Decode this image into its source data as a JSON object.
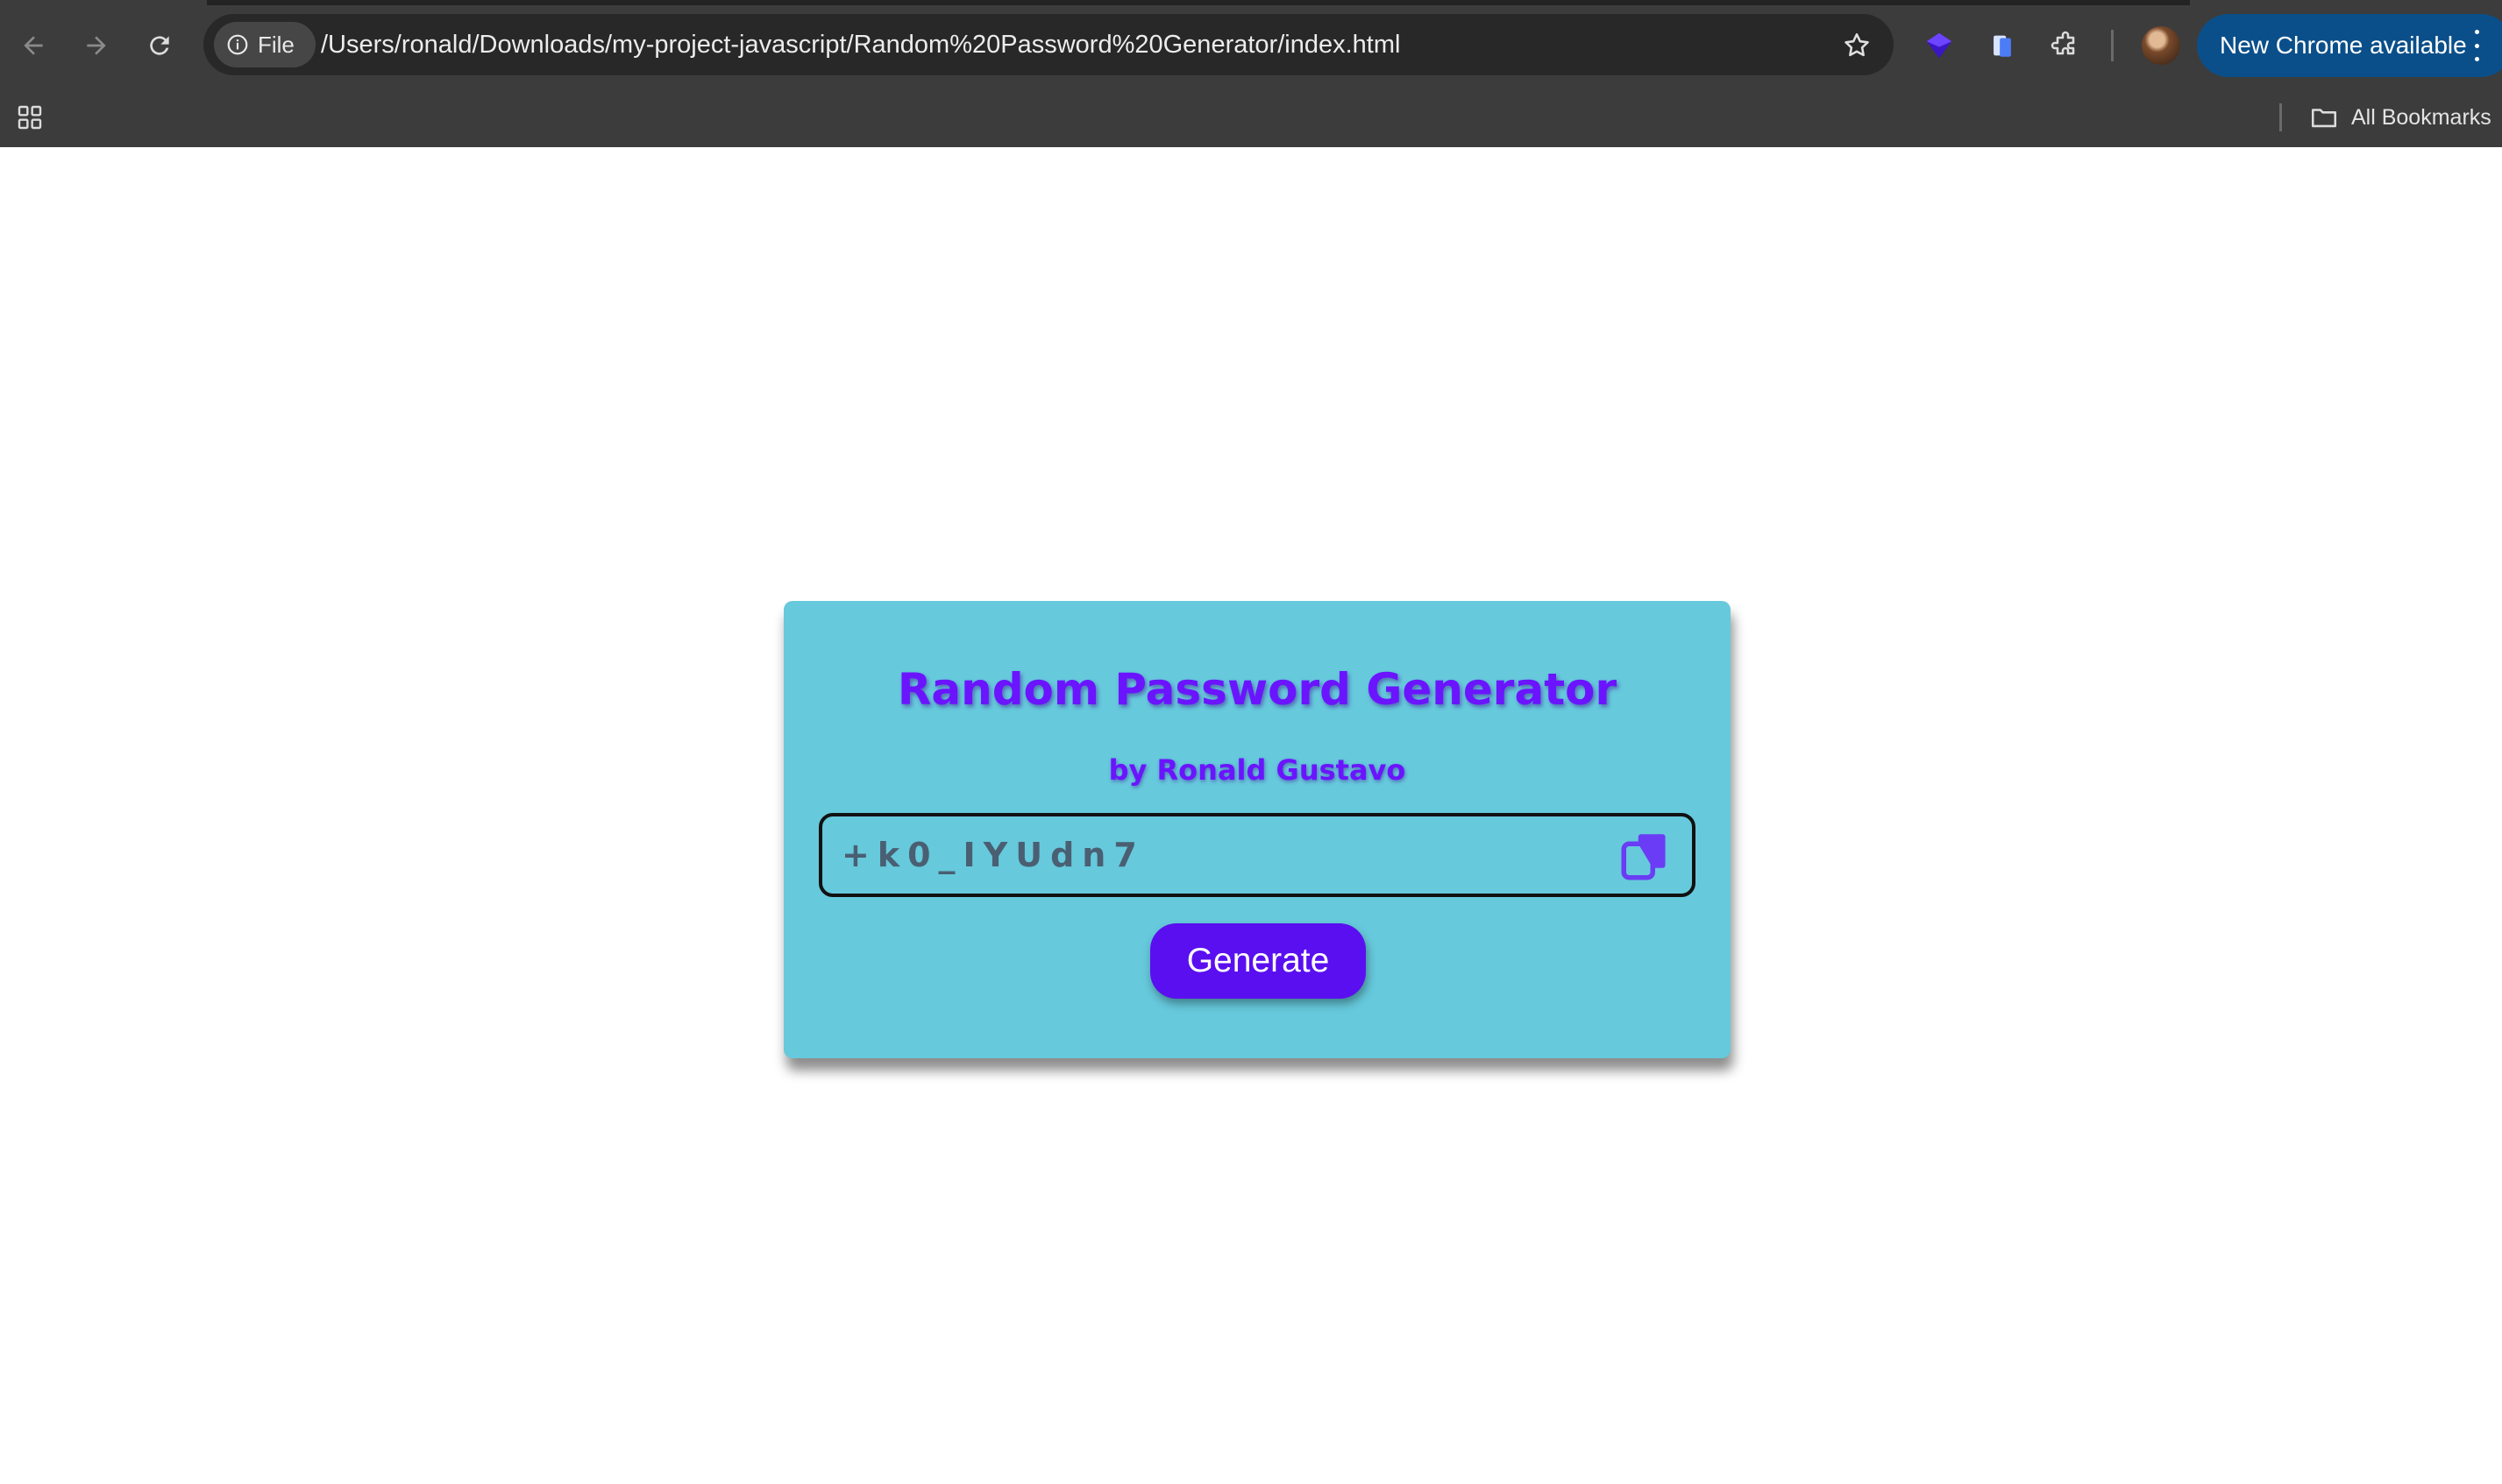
{
  "browser": {
    "site_chip_label": "File",
    "url": "/Users/ronald/Downloads/my-project-javascript/Random%20Password%20Generator/index.html",
    "update_button_label": "New Chrome available",
    "bookmarks_label": "All Bookmarks",
    "icons": [
      "back-icon",
      "forward-icon",
      "reload-icon",
      "info-icon",
      "star-icon",
      "extension-icon",
      "puzzle-icon",
      "apps-grid-icon",
      "folder-icon"
    ]
  },
  "app": {
    "title": "Random Password Generator",
    "subtitle": "by Ronald Gustavo",
    "password_value": "+k0_IYUdn7",
    "generate_label": "Generate",
    "colors": {
      "card_background": "#66c9dc",
      "accent": "#6b14ff",
      "button": "#5a0ff0"
    }
  }
}
